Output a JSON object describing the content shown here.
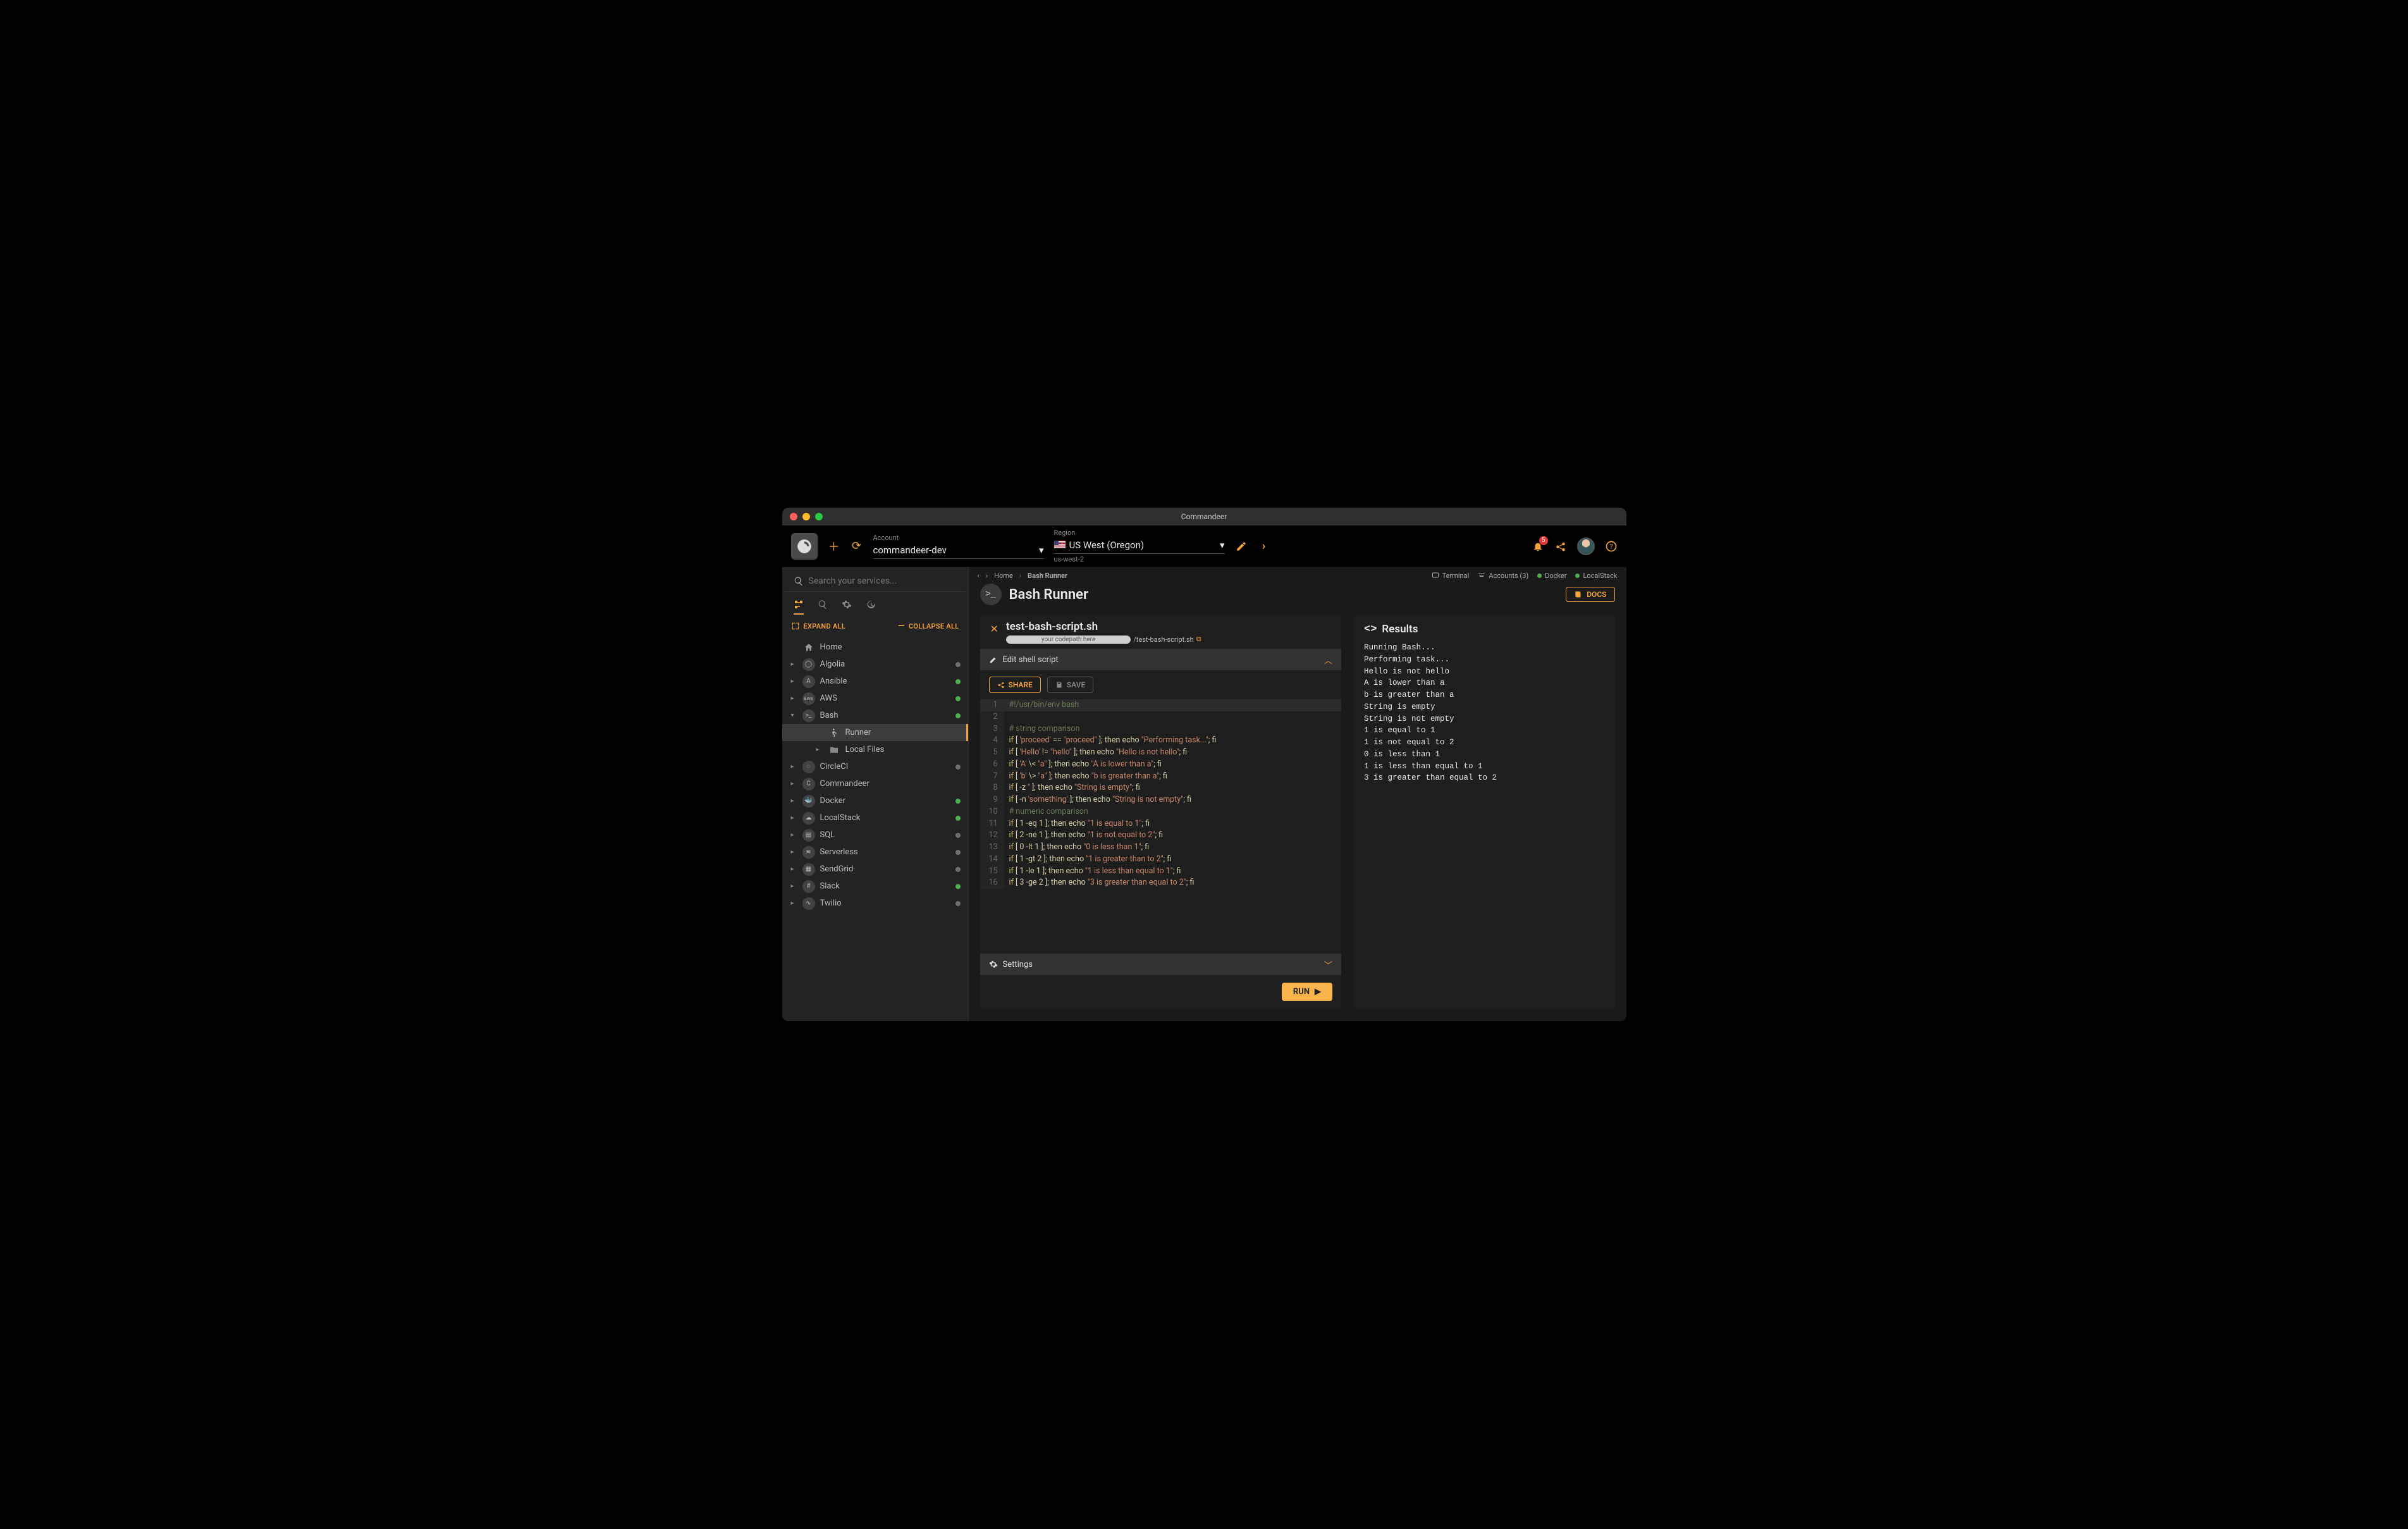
{
  "window_title": "Commandeer",
  "header": {
    "account_label": "Account",
    "account_value": "commandeer-dev",
    "region_label": "Region",
    "region_value": "US West (Oregon)",
    "region_code": "us-west-2",
    "notif_count": "5"
  },
  "sidebar": {
    "search_placeholder": "Search your services...",
    "expand_all": "EXPAND ALL",
    "collapse_all": "COLLAPSE ALL",
    "home": "Home",
    "items": [
      {
        "label": "Algolia",
        "status": "grey"
      },
      {
        "label": "Ansible",
        "status": "green"
      },
      {
        "label": "AWS",
        "status": "green"
      },
      {
        "label": "Bash",
        "status": "green"
      },
      {
        "label": "CircleCI",
        "status": "grey"
      },
      {
        "label": "Commandeer",
        "status": "none"
      },
      {
        "label": "Docker",
        "status": "green"
      },
      {
        "label": "LocalStack",
        "status": "green"
      },
      {
        "label": "SQL",
        "status": "grey"
      },
      {
        "label": "Serverless",
        "status": "grey"
      },
      {
        "label": "SendGrid",
        "status": "grey"
      },
      {
        "label": "Slack",
        "status": "green"
      },
      {
        "label": "Twilio",
        "status": "grey"
      }
    ],
    "bash_children": [
      {
        "label": "Runner"
      },
      {
        "label": "Local Files"
      }
    ]
  },
  "breadcrumbs": {
    "home": "Home",
    "current": "Bash Runner"
  },
  "status_strip": {
    "terminal": "Terminal",
    "accounts": "Accounts (3)",
    "docker": "Docker",
    "localstack": "LocalStack"
  },
  "page": {
    "title": "Bash Runner",
    "docs": "DOCS"
  },
  "file": {
    "name": "test-bash-script.sh",
    "codepath_placeholder": "your codepath here",
    "path_tail": "/test-bash-script.sh"
  },
  "panels": {
    "edit_shell": "Edit shell script",
    "settings": "Settings"
  },
  "buttons": {
    "share": "SHARE",
    "save": "SAVE",
    "run": "RUN"
  },
  "code_lines": [
    {
      "n": 1,
      "tokens": [
        [
          "comment",
          "#!/usr/bin/env bash"
        ]
      ]
    },
    {
      "n": 2,
      "tokens": []
    },
    {
      "n": 3,
      "tokens": [
        [
          "comment",
          "# string comparison"
        ]
      ]
    },
    {
      "n": 4,
      "tokens": [
        [
          "kw",
          "if"
        ],
        [
          "plain",
          " [ "
        ],
        [
          "str",
          "'proceed'"
        ],
        [
          "plain",
          " == "
        ],
        [
          "str",
          "\"proceed\""
        ],
        [
          "plain",
          " ]; then echo "
        ],
        [
          "str",
          "\"Performing task...\""
        ],
        [
          "plain",
          "; fi"
        ]
      ]
    },
    {
      "n": 5,
      "tokens": [
        [
          "kw",
          "if"
        ],
        [
          "plain",
          " [ "
        ],
        [
          "str",
          "'Hello'"
        ],
        [
          "plain",
          " != "
        ],
        [
          "str",
          "\"hello\""
        ],
        [
          "plain",
          " ]; then echo "
        ],
        [
          "str",
          "\"Hello is not hello\""
        ],
        [
          "plain",
          "; fi"
        ]
      ]
    },
    {
      "n": 6,
      "tokens": [
        [
          "kw",
          "if"
        ],
        [
          "plain",
          " [ "
        ],
        [
          "str",
          "'A'"
        ],
        [
          "plain",
          " \\< "
        ],
        [
          "str",
          "\"a\""
        ],
        [
          "plain",
          " ]; then echo "
        ],
        [
          "str",
          "\"A is lower than a\""
        ],
        [
          "plain",
          "; fi"
        ]
      ]
    },
    {
      "n": 7,
      "tokens": [
        [
          "kw",
          "if"
        ],
        [
          "plain",
          " [ "
        ],
        [
          "str",
          "'b'"
        ],
        [
          "plain",
          " \\> "
        ],
        [
          "str",
          "\"a\""
        ],
        [
          "plain",
          " ]; then echo "
        ],
        [
          "str",
          "\"b is greater than a\""
        ],
        [
          "plain",
          "; fi"
        ]
      ]
    },
    {
      "n": 8,
      "tokens": [
        [
          "kw",
          "if"
        ],
        [
          "plain",
          " [ -z "
        ],
        [
          "str",
          "''"
        ],
        [
          "plain",
          " ]; then echo "
        ],
        [
          "str",
          "\"String is empty\""
        ],
        [
          "plain",
          "; fi"
        ]
      ]
    },
    {
      "n": 9,
      "tokens": [
        [
          "kw",
          "if"
        ],
        [
          "plain",
          " [ -n "
        ],
        [
          "str",
          "'something'"
        ],
        [
          "plain",
          " ]; then echo "
        ],
        [
          "str",
          "\"String is not empty\""
        ],
        [
          "plain",
          "; fi"
        ]
      ]
    },
    {
      "n": 10,
      "tokens": [
        [
          "comment",
          "# numeric comparison"
        ]
      ]
    },
    {
      "n": 11,
      "tokens": [
        [
          "kw",
          "if"
        ],
        [
          "plain",
          " [ 1 -eq 1 ]; then echo "
        ],
        [
          "str",
          "\"1 is equal to 1\""
        ],
        [
          "plain",
          "; fi"
        ]
      ]
    },
    {
      "n": 12,
      "tokens": [
        [
          "kw",
          "if"
        ],
        [
          "plain",
          " [ 2 -ne 1 ]; then echo "
        ],
        [
          "str",
          "\"1 is not equal to 2\""
        ],
        [
          "plain",
          "; fi"
        ]
      ]
    },
    {
      "n": 13,
      "tokens": [
        [
          "kw",
          "if"
        ],
        [
          "plain",
          " [ 0 -lt 1 ]; then echo "
        ],
        [
          "str",
          "\"0 is less than 1\""
        ],
        [
          "plain",
          "; fi"
        ]
      ]
    },
    {
      "n": 14,
      "tokens": [
        [
          "kw",
          "if"
        ],
        [
          "plain",
          " [ 1 -gt 2 ]; then echo "
        ],
        [
          "str",
          "\"1 is greater than to 2\""
        ],
        [
          "plain",
          "; fi"
        ]
      ]
    },
    {
      "n": 15,
      "tokens": [
        [
          "kw",
          "if"
        ],
        [
          "plain",
          " [ 1 -le 1 ]; then echo "
        ],
        [
          "str",
          "\"1 is less than equal to 1\""
        ],
        [
          "plain",
          "; fi"
        ]
      ]
    },
    {
      "n": 16,
      "tokens": [
        [
          "kw",
          "if"
        ],
        [
          "plain",
          " [ 3 -ge 2 ]; then echo "
        ],
        [
          "str",
          "\"3 is greater than equal to 2\""
        ],
        [
          "plain",
          "; fi"
        ]
      ]
    }
  ],
  "results": {
    "title": "Results",
    "lines": [
      "Running Bash...",
      "Performing task...",
      "Hello is not hello",
      "A is lower than a",
      "b is greater than a",
      "String is empty",
      "String is not empty",
      "1 is equal to 1",
      "1 is not equal to 2",
      "0 is less than 1",
      "1 is less than equal to 1",
      "3 is greater than equal to 2"
    ]
  }
}
